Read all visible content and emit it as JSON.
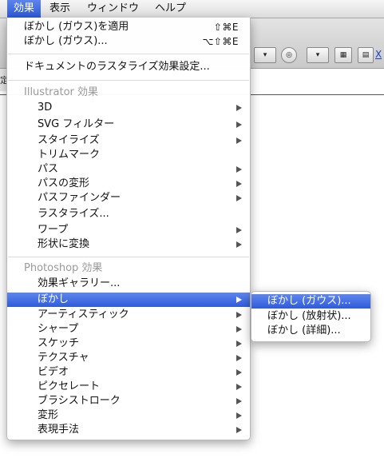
{
  "menubar": {
    "items": [
      {
        "label": "効果"
      },
      {
        "label": "表示"
      },
      {
        "label": "ウィンドウ"
      },
      {
        "label": "ヘルプ"
      }
    ]
  },
  "app": {
    "tab_glyph": "定",
    "link_text": "X"
  },
  "effect_menu": {
    "apply_last": {
      "label": "ぼかし (ガウス)を適用",
      "shortcut": "⇧⌘E"
    },
    "last_effect": {
      "label": "ぼかし (ガウス)...",
      "shortcut": "⌥⇧⌘E"
    },
    "raster_settings": {
      "label": "ドキュメントのラスタライズ効果設定..."
    },
    "illustrator_header": "Illustrator 効果",
    "illustrator_items": [
      {
        "label": "3D",
        "submenu": true
      },
      {
        "label": "SVG フィルター",
        "submenu": true
      },
      {
        "label": "スタイライズ",
        "submenu": true
      },
      {
        "label": "トリムマーク",
        "submenu": false
      },
      {
        "label": "パス",
        "submenu": true
      },
      {
        "label": "パスの変形",
        "submenu": true
      },
      {
        "label": "パスファインダー",
        "submenu": true
      },
      {
        "label": "ラスタライズ...",
        "submenu": false
      },
      {
        "label": "ワープ",
        "submenu": true
      },
      {
        "label": "形状に変換",
        "submenu": true
      }
    ],
    "photoshop_header": "Photoshop 効果",
    "photoshop_items": [
      {
        "label": "効果ギャラリー...",
        "submenu": false
      },
      {
        "label": "ぼかし",
        "submenu": true,
        "highlighted": true
      },
      {
        "label": "アーティスティック",
        "submenu": true
      },
      {
        "label": "シャープ",
        "submenu": true
      },
      {
        "label": "スケッチ",
        "submenu": true
      },
      {
        "label": "テクスチャ",
        "submenu": true
      },
      {
        "label": "ビデオ",
        "submenu": true
      },
      {
        "label": "ピクセレート",
        "submenu": true
      },
      {
        "label": "ブラシストローク",
        "submenu": true
      },
      {
        "label": "変形",
        "submenu": true
      },
      {
        "label": "表現手法",
        "submenu": true
      }
    ]
  },
  "blur_submenu": {
    "items": [
      {
        "label": "ぼかし (ガウス)...",
        "highlighted": true
      },
      {
        "label": "ぼかし (放射状)..."
      },
      {
        "label": "ぼかし (詳細)..."
      }
    ]
  },
  "colors": {
    "highlight": "#3a64de",
    "header_text": "#9a9a9a"
  },
  "icons": {
    "submenu_indicator": "chevron-right-icon"
  }
}
